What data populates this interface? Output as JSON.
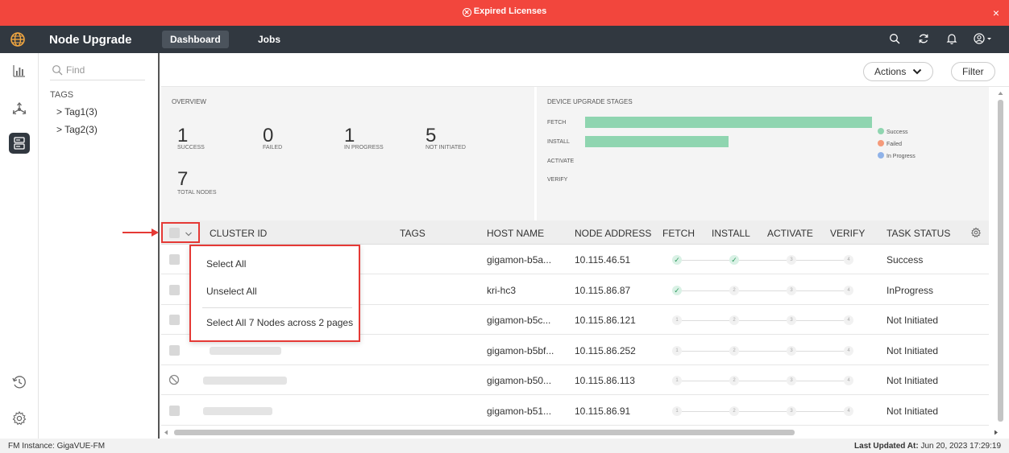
{
  "banner": {
    "text": "Expired Licenses",
    "close": "×",
    "color": "#f2463d"
  },
  "topbar": {
    "app_title": "Node Upgrade",
    "tabs": [
      {
        "label": "Dashboard",
        "active": true
      },
      {
        "label": "Jobs",
        "active": false
      }
    ],
    "icons": [
      "search-icon",
      "refresh-icon",
      "bell-icon",
      "user-icon"
    ]
  },
  "rail": {
    "icons": [
      "chart-icon",
      "topology-icon",
      "server-icon",
      "history-icon",
      "settings-icon"
    ]
  },
  "tags_pane": {
    "search_placeholder": "Find",
    "tags_heading": "TAGS",
    "tags": [
      "> Tag1(3)",
      "> Tag2(3)"
    ]
  },
  "actions": {
    "actions_label": "Actions",
    "filter_label": "Filter"
  },
  "overview": {
    "heading": "OVERVIEW",
    "stats": [
      {
        "value": "1",
        "label": "SUCCESS"
      },
      {
        "value": "0",
        "label": "FAILED"
      },
      {
        "value": "1",
        "label": "IN PROGRESS"
      },
      {
        "value": "5",
        "label": "NOT INITIATED"
      },
      {
        "value": "7",
        "label": "TOTAL NODES"
      }
    ]
  },
  "stages": {
    "heading": "DEVICE UPGRADE STAGES",
    "rows": [
      {
        "label": "FETCH",
        "success_fraction": 1.0
      },
      {
        "label": "INSTALL",
        "success_fraction": 0.5
      },
      {
        "label": "ACTIVATE",
        "success_fraction": 0
      },
      {
        "label": "VERIFY",
        "success_fraction": 0
      }
    ],
    "legend": [
      {
        "label": "Success",
        "color": "#8fd5b0"
      },
      {
        "label": "Failed",
        "color": "#f59a7a"
      },
      {
        "label": "In Progress",
        "color": "#8fb2e8"
      }
    ]
  },
  "table": {
    "columns": [
      "CLUSTER ID",
      "TAGS",
      "HOST NAME",
      "NODE ADDRESS",
      "FETCH",
      "INSTALL",
      "ACTIVATE",
      "VERIFY",
      "TASK STATUS"
    ],
    "rows": [
      {
        "host": "gigamon-b5a...",
        "address": "10.115.46.51",
        "steps": [
          "done",
          "done",
          "3",
          "4"
        ],
        "status": "Success",
        "check": "box"
      },
      {
        "host": "kri-hc3",
        "address": "10.115.86.87",
        "steps": [
          "done",
          "2",
          "3",
          "4"
        ],
        "status": "InProgress",
        "check": "box"
      },
      {
        "host": "gigamon-b5c...",
        "address": "10.115.86.121",
        "steps": [
          "1",
          "2",
          "3",
          "4"
        ],
        "status": "Not Initiated",
        "check": "box"
      },
      {
        "host": "gigamon-b5bf...",
        "address": "10.115.86.252",
        "steps": [
          "1",
          "2",
          "3",
          "4"
        ],
        "status": "Not Initiated",
        "check": "box"
      },
      {
        "host": "gigamon-b50...",
        "address": "10.115.86.113",
        "steps": [
          "1",
          "2",
          "3",
          "4"
        ],
        "status": "Not Initiated",
        "check": "blocked"
      },
      {
        "host": "gigamon-b51...",
        "address": "10.115.86.91",
        "steps": [
          "1",
          "2",
          "3",
          "4"
        ],
        "status": "Not Initiated",
        "check": "box"
      }
    ]
  },
  "select_menu": {
    "items": [
      "Select All",
      "Unselect All",
      "Select All 7 Nodes across 2 pages"
    ]
  },
  "footer": {
    "instance_label": "FM Instance:",
    "instance_value": "GigaVUE-FM",
    "updated_label": "Last Updated At:",
    "updated_value": "Jun 20, 2023 17:29:19"
  }
}
